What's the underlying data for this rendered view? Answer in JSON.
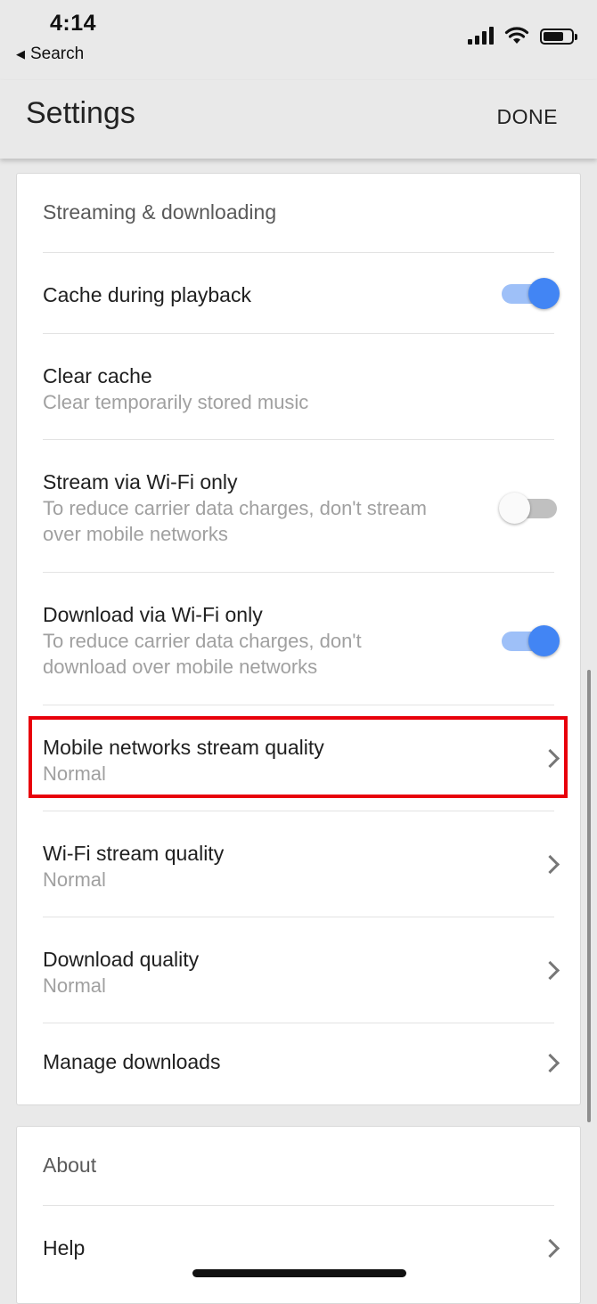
{
  "status": {
    "time": "4:14",
    "back_label": "Search"
  },
  "header": {
    "title": "Settings",
    "done_label": "DONE"
  },
  "streaming": {
    "section_title": "Streaming & downloading",
    "cache_playback": {
      "label": "Cache during playback",
      "enabled": true
    },
    "clear_cache": {
      "label": "Clear cache",
      "description": "Clear temporarily stored music"
    },
    "stream_wifi_only": {
      "label": "Stream via Wi-Fi only",
      "description_line1": "To reduce carrier data charges, don't stream",
      "description_line2": "over mobile networks",
      "enabled": false
    },
    "download_wifi_only": {
      "label": "Download via Wi-Fi only",
      "description_line1": "To reduce carrier data charges, don't",
      "description_line2": "download over mobile networks",
      "enabled": true
    },
    "mobile_quality": {
      "label": "Mobile networks stream quality",
      "value": "Normal"
    },
    "wifi_quality": {
      "label": "Wi-Fi stream quality",
      "value": "Normal"
    },
    "download_quality": {
      "label": "Download quality",
      "value": "Normal"
    },
    "manage_downloads": {
      "label": "Manage downloads"
    }
  },
  "about": {
    "section_title": "About",
    "help_label": "Help"
  },
  "colors": {
    "accent": "#4285f4",
    "highlight": "#e8000b"
  }
}
